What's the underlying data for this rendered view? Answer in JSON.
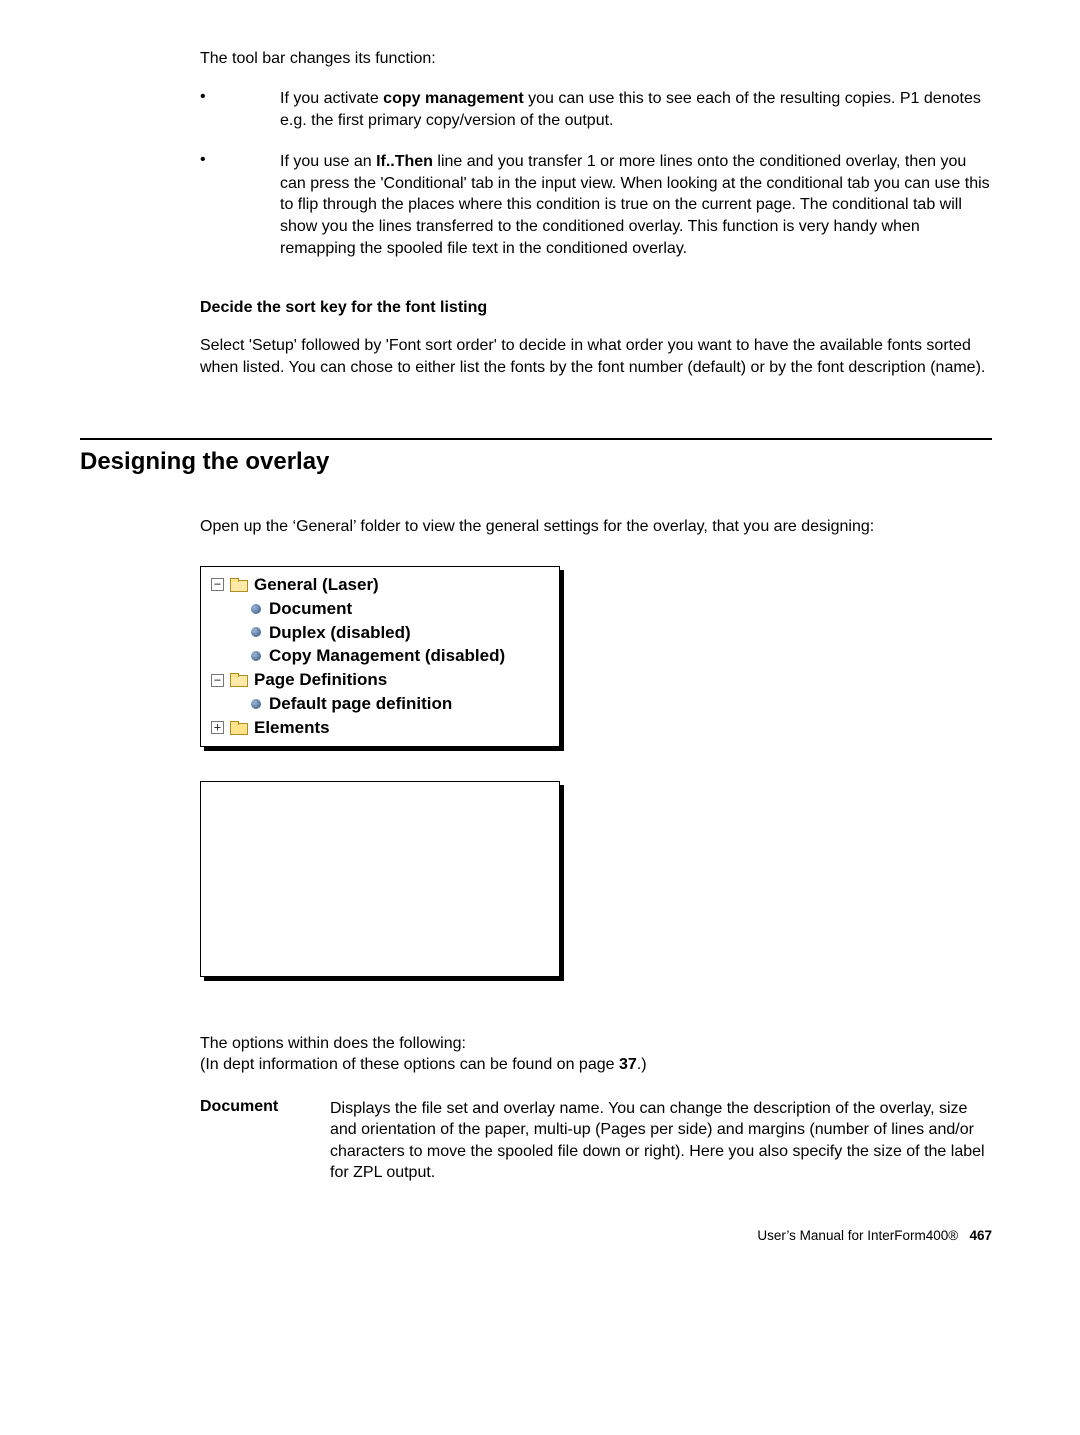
{
  "intro": "The tool bar changes its function:",
  "bullets": [
    {
      "pre": "If you activate ",
      "bold": "copy management",
      "post": " you can use this to see each of the resulting copies. P1 denotes e.g. the first primary copy/version of the output."
    },
    {
      "pre": "If you use an ",
      "bold": "If..Then",
      "post": " line and you transfer 1 or more lines onto the conditioned overlay, then you can press the 'Conditional' tab in the input view. When looking at the conditional tab you can use this to flip through the places where this condition is true on the current page. The conditional tab will show you the lines transferred to the conditioned overlay. This function is very handy when remapping the spooled file text in the conditioned overlay."
    }
  ],
  "sortkey": {
    "heading": "Decide the sort key for the font listing",
    "body": "Select 'Setup' followed by 'Font sort order' to decide in what order you want to have the available fonts sorted when listed. You can chose to either list the fonts by the font number (default) or by the font description (name)."
  },
  "section_title": "Designing the overlay",
  "design_intro": "Open up the ‘General’ folder to view the general settings for the overlay, that you are designing:",
  "tree": {
    "general": "General (Laser)",
    "document": "Document",
    "duplex": "Duplex (disabled)",
    "copymgmt": "Copy Management (disabled)",
    "pagedefs": "Page Definitions",
    "defaultpage": "Default page definition",
    "elements": "Elements",
    "minus": "−",
    "plus": "+"
  },
  "options_intro_line1": "The options within does the following:",
  "options_intro_line2_pre": "(In dept information of these options can be found on page ",
  "options_intro_line2_bold": "37",
  "options_intro_line2_post": ".)",
  "def": {
    "term": "Document",
    "desc": "Displays the file set and overlay name. You can change the description of the overlay, size and orientation of the paper, multi-up (Pages per side) and margins (number of lines and/or characters to move the spooled file down or right). Here you also specify the size of the label for ZPL output."
  },
  "footer": {
    "text": "User’s Manual for InterForm400®",
    "page": "467"
  }
}
